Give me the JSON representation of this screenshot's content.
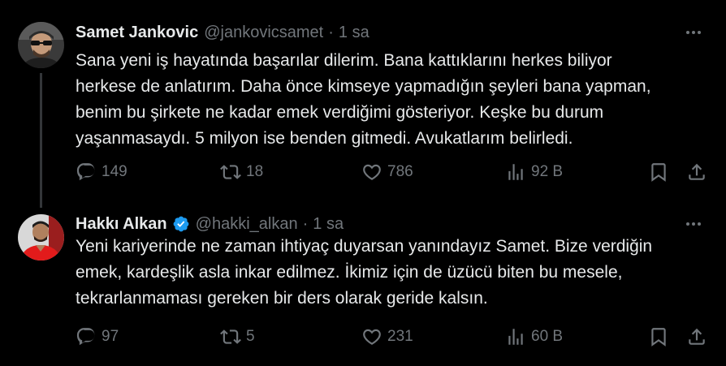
{
  "tweets": [
    {
      "display_name": "Samet Jankovic",
      "handle": "@jankovicsamet",
      "separator": "·",
      "time": "1 sa",
      "verified": false,
      "text_lines": [
        "Sana yeni iş hayatında başarılar dilerim. Bana kattıklarını herkes biliyor",
        "herkese de anlatırım. Daha önce kimseye yapmadığın şeyleri bana yapman,",
        "benim bu şirkete ne kadar emek verdiğimi gösteriyor. Keşke bu durum",
        "yaşanmasaydı. 5 milyon ise benden gitmedi. Avukatlarım belirledi."
      ],
      "replies": "149",
      "reposts": "18",
      "likes": "786",
      "views": "92 B"
    },
    {
      "display_name": "Hakkı Alkan",
      "handle": "@hakki_alkan",
      "separator": "·",
      "time": "1 sa",
      "verified": true,
      "text_lines": [
        "Yeni kariyerinde ne zaman ihtiyaç duyarsan yanındayız Samet. Bize verdiğin",
        "emek, kardeşlik asla inkar edilmez. İkimiz için de üzücü biten bu mesele,",
        "tekrarlanmaması gereken bir ders olarak geride kalsın."
      ],
      "replies": "97",
      "reposts": "5",
      "likes": "231",
      "views": "60 B"
    }
  ],
  "colors": {
    "background": "#000000",
    "text_primary": "#e7e9ea",
    "text_secondary": "#71767b",
    "verified_blue": "#1d9bf0",
    "thread_line": "#333639"
  },
  "icons": [
    "reply-icon",
    "repost-icon",
    "like-icon",
    "views-icon",
    "bookmark-icon",
    "share-icon",
    "more-icon",
    "verified-badge-icon"
  ]
}
